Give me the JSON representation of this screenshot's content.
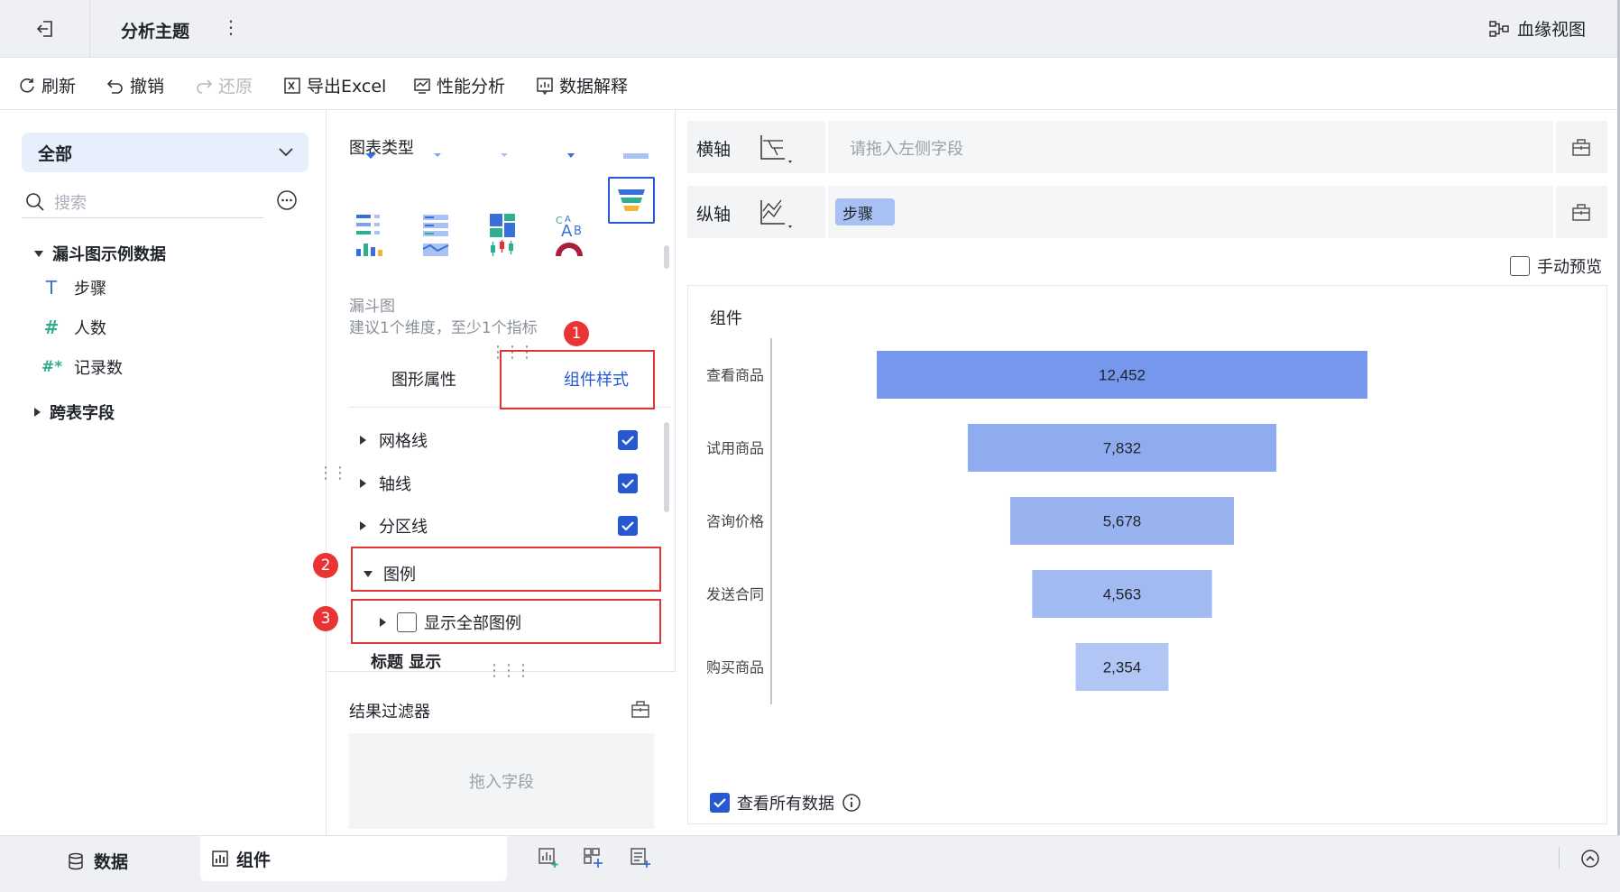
{
  "topbar": {
    "title": "分析主题",
    "kebab": "⋮",
    "lineage_label": "血缘视图"
  },
  "toolbar": {
    "refresh": "刷新",
    "undo": "撤销",
    "redo": "还原",
    "export_excel": "导出Excel",
    "performance": "性能分析",
    "data_explain": "数据解释"
  },
  "left_panel": {
    "scope": "全部",
    "search_placeholder": "搜索",
    "dataset_name": "漏斗图示例数据",
    "fields": [
      {
        "icon": "T",
        "name": "步骤"
      },
      {
        "icon": "#",
        "name": "人数"
      },
      {
        "icon": "#*",
        "name": "记录数"
      }
    ],
    "cross_table": "跨表字段"
  },
  "middle_panel": {
    "chart_type_title": "图表类型",
    "selected_chart_name": "漏斗图",
    "selected_chart_hint": "建议1个维度，至少1个指标",
    "tabs": [
      "图形属性",
      "组件样式"
    ],
    "active_tab": "组件样式",
    "properties": [
      {
        "label": "网格线",
        "checked": true
      },
      {
        "label": "轴线",
        "checked": true
      },
      {
        "label": "分区线",
        "checked": true
      }
    ],
    "legend_label": "图例",
    "show_all_legend": "显示全部图例",
    "show_all_legend_checked": false,
    "partial_row_text": "标题 显示",
    "callouts": [
      "1",
      "2",
      "3"
    ],
    "filter_title": "结果过滤器",
    "filter_drop_hint": "拖入字段"
  },
  "right_panel": {
    "x_axis_label": "横轴",
    "x_axis_placeholder": "请拖入左侧字段",
    "y_axis_label": "纵轴",
    "y_axis_field": "步骤",
    "manual_preview": "手动预览",
    "widget_title": "组件",
    "view_all_data": "查看所有数据",
    "view_all_checked": true
  },
  "chart_data": {
    "type": "bar",
    "subtype": "funnel",
    "categories": [
      "查看商品",
      "试用商品",
      "咨询价格",
      "发送合同",
      "购买商品"
    ],
    "values": [
      12452,
      7832,
      5678,
      4563,
      2354
    ],
    "value_labels": [
      "12,452",
      "7,832",
      "5,678",
      "4,563",
      "2,354"
    ],
    "colors": [
      "#7598ec",
      "#90acf0",
      "#99b3f1",
      "#a2baf2",
      "#b2c6f5"
    ],
    "title": "",
    "xlabel": "",
    "ylabel": "",
    "grid": false,
    "legend": "none"
  },
  "bottombar": {
    "data_tab": "数据",
    "widget_tab": "组件"
  },
  "theme": {
    "accent": "#2659d1",
    "callout_red": "#e13434"
  }
}
